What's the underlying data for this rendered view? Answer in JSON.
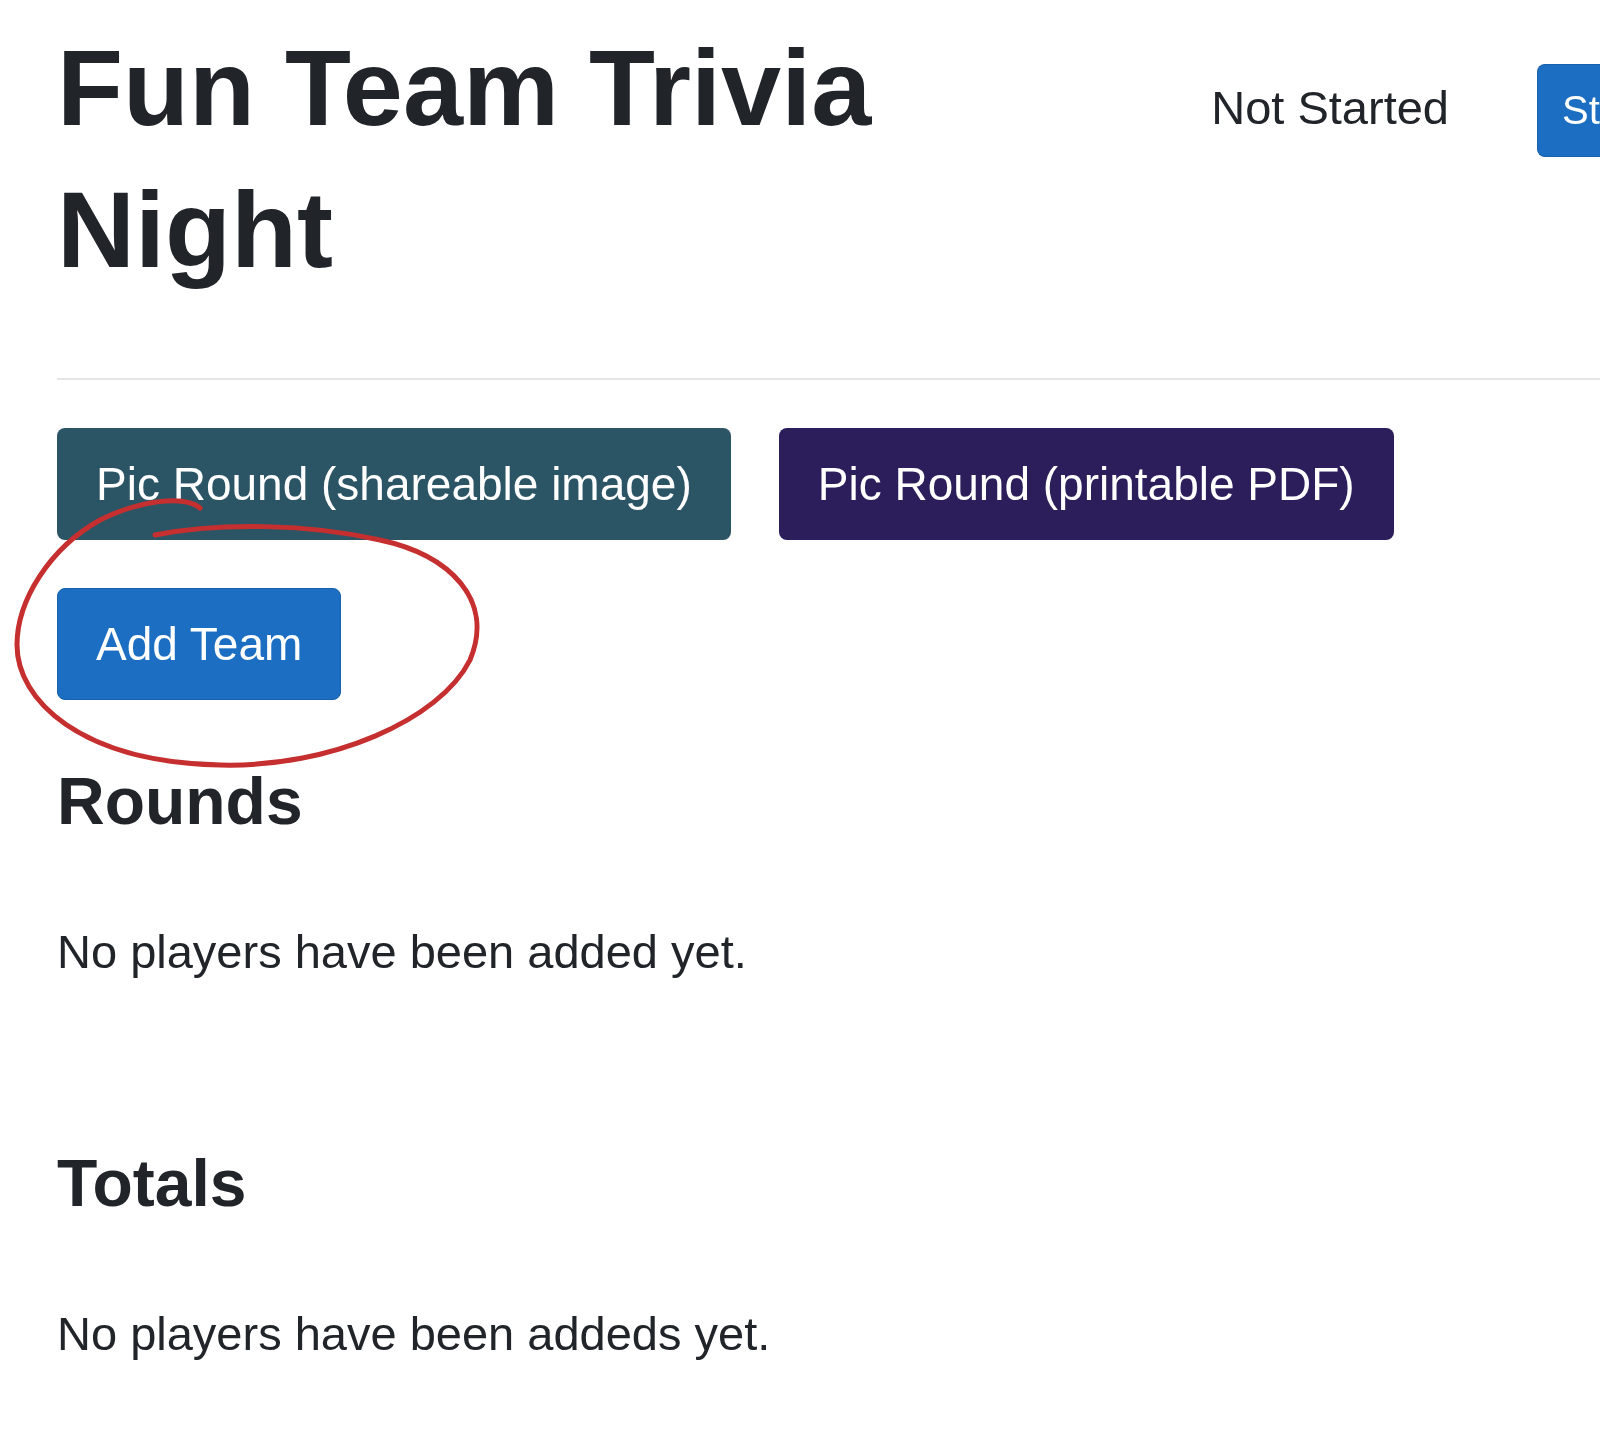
{
  "header": {
    "title": "Fun Team Trivia Night",
    "status": "Not Started",
    "start_button": "St"
  },
  "actions": [
    {
      "label": "Pic Round (shareable image)",
      "kind": "shareable"
    },
    {
      "label": "Pic Round (printable PDF)",
      "kind": "printable"
    }
  ],
  "add_team_button": "Add Team",
  "annotation": {
    "kind": "circle"
  },
  "sections": [
    {
      "heading": "Rounds",
      "message": "No players have been added yet."
    },
    {
      "heading": "Totals",
      "message": "No players have been addeds yet."
    }
  ]
}
